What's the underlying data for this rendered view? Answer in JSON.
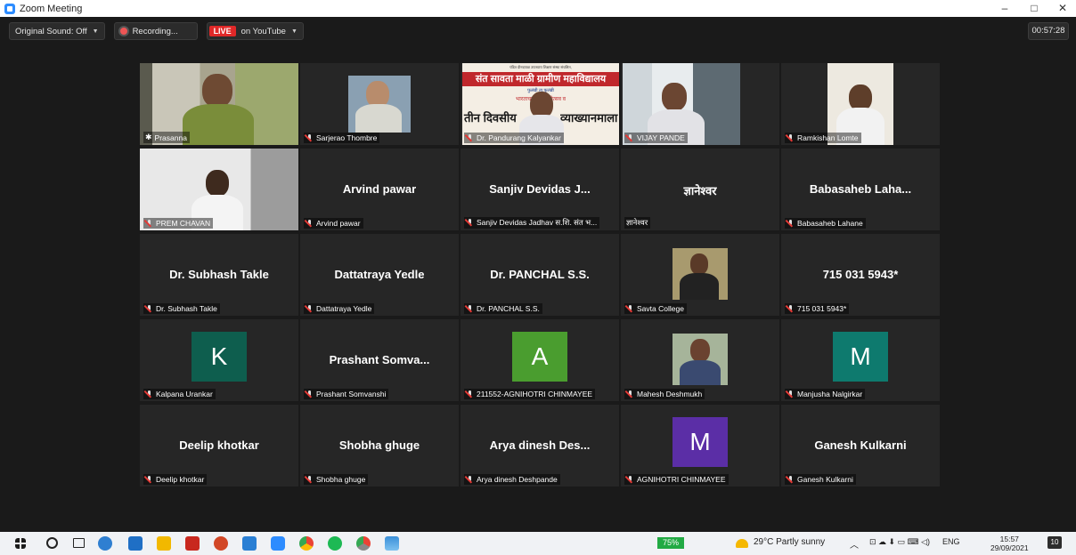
{
  "window": {
    "title": "Zoom Meeting",
    "minimize": "–",
    "maximize": "□",
    "close": "✕"
  },
  "toolbar": {
    "original_sound": "Original Sound: Off",
    "recording": "Recording...",
    "live_badge": "LIVE",
    "live_target": "on YouTube",
    "timer": "00:57:28"
  },
  "tiles": [
    {
      "name": "Prasanna",
      "type": "video",
      "active": true
    },
    {
      "name": "Sarjerao Thombre",
      "type": "video"
    },
    {
      "name": "Dr. Pandurang Kalyankar",
      "type": "video",
      "banner": [
        "पंडित दीनदयाळ उपाध्याय शिक्षण संस्था संचलित,",
        "संत सावता माळी ग्रामीण महाविद्यालय",
        "फुलंब्री ता.फुलंब्री",
        "भारताचा अमृत महोत्सव व",
        "तीन दिवसीय",
        "व्याख्यानमाला"
      ]
    },
    {
      "name": "VIJAY PANDE",
      "type": "video"
    },
    {
      "name": "Ramkishan Lomte",
      "type": "video"
    },
    {
      "name": "PREM CHAVAN",
      "type": "video"
    },
    {
      "name": "Arvind pawar",
      "type": "name",
      "display": "Arvind pawar"
    },
    {
      "name": "Sanjiv Devidas Jadhav स.शि. संत भ...",
      "type": "name",
      "display": "Sanjiv Devidas J..."
    },
    {
      "name": "ज्ञानेश्वर",
      "type": "name",
      "display": "ज्ञानेश्वर",
      "nomic": true
    },
    {
      "name": "Babasaheb Lahane",
      "type": "name",
      "display": "Babasaheb Laha..."
    },
    {
      "name": "Dr. Subhash Takle",
      "type": "name",
      "display": "Dr. Subhash Takle"
    },
    {
      "name": "Dattatraya Yedle",
      "type": "name",
      "display": "Dattatraya Yedle"
    },
    {
      "name": "Dr. PANCHAL S.S.",
      "type": "name",
      "display": "Dr. PANCHAL S.S."
    },
    {
      "name": "Savta College",
      "type": "photo"
    },
    {
      "name": "715 031 5943*",
      "type": "name",
      "display": "715 031 5943*"
    },
    {
      "name": "Kalpana Urankar",
      "type": "avatar",
      "letter": "K",
      "color": "#0e5e4e"
    },
    {
      "name": "Prashant Somvanshi",
      "type": "name",
      "display": "Prashant Somva..."
    },
    {
      "name": "211552-AGNIHOTRI CHINMAYEE",
      "type": "avatar",
      "letter": "A",
      "color": "#4a9d2f"
    },
    {
      "name": "Mahesh Deshmukh",
      "type": "photo"
    },
    {
      "name": "Manjusha Nalgirkar",
      "type": "avatar",
      "letter": "M",
      "color": "#0e7a6e"
    },
    {
      "name": "Deelip khotkar",
      "type": "name",
      "display": "Deelip khotkar"
    },
    {
      "name": "Shobha ghuge",
      "type": "name",
      "display": "Shobha ghuge"
    },
    {
      "name": "Arya dinesh Deshpande",
      "type": "name",
      "display": "Arya dinesh Des..."
    },
    {
      "name": "AGNIHOTRI CHINMAYEE",
      "type": "avatar",
      "letter": "M",
      "color": "#5b2ea6"
    },
    {
      "name": "Ganesh Kulkarni",
      "type": "name",
      "display": "Ganesh Kulkarni"
    }
  ],
  "taskbar": {
    "battery": "75%",
    "weather": "29°C  Partly sunny",
    "lang": "ENG",
    "time": "15:57",
    "date": "29/09/2021",
    "notif": "10"
  }
}
